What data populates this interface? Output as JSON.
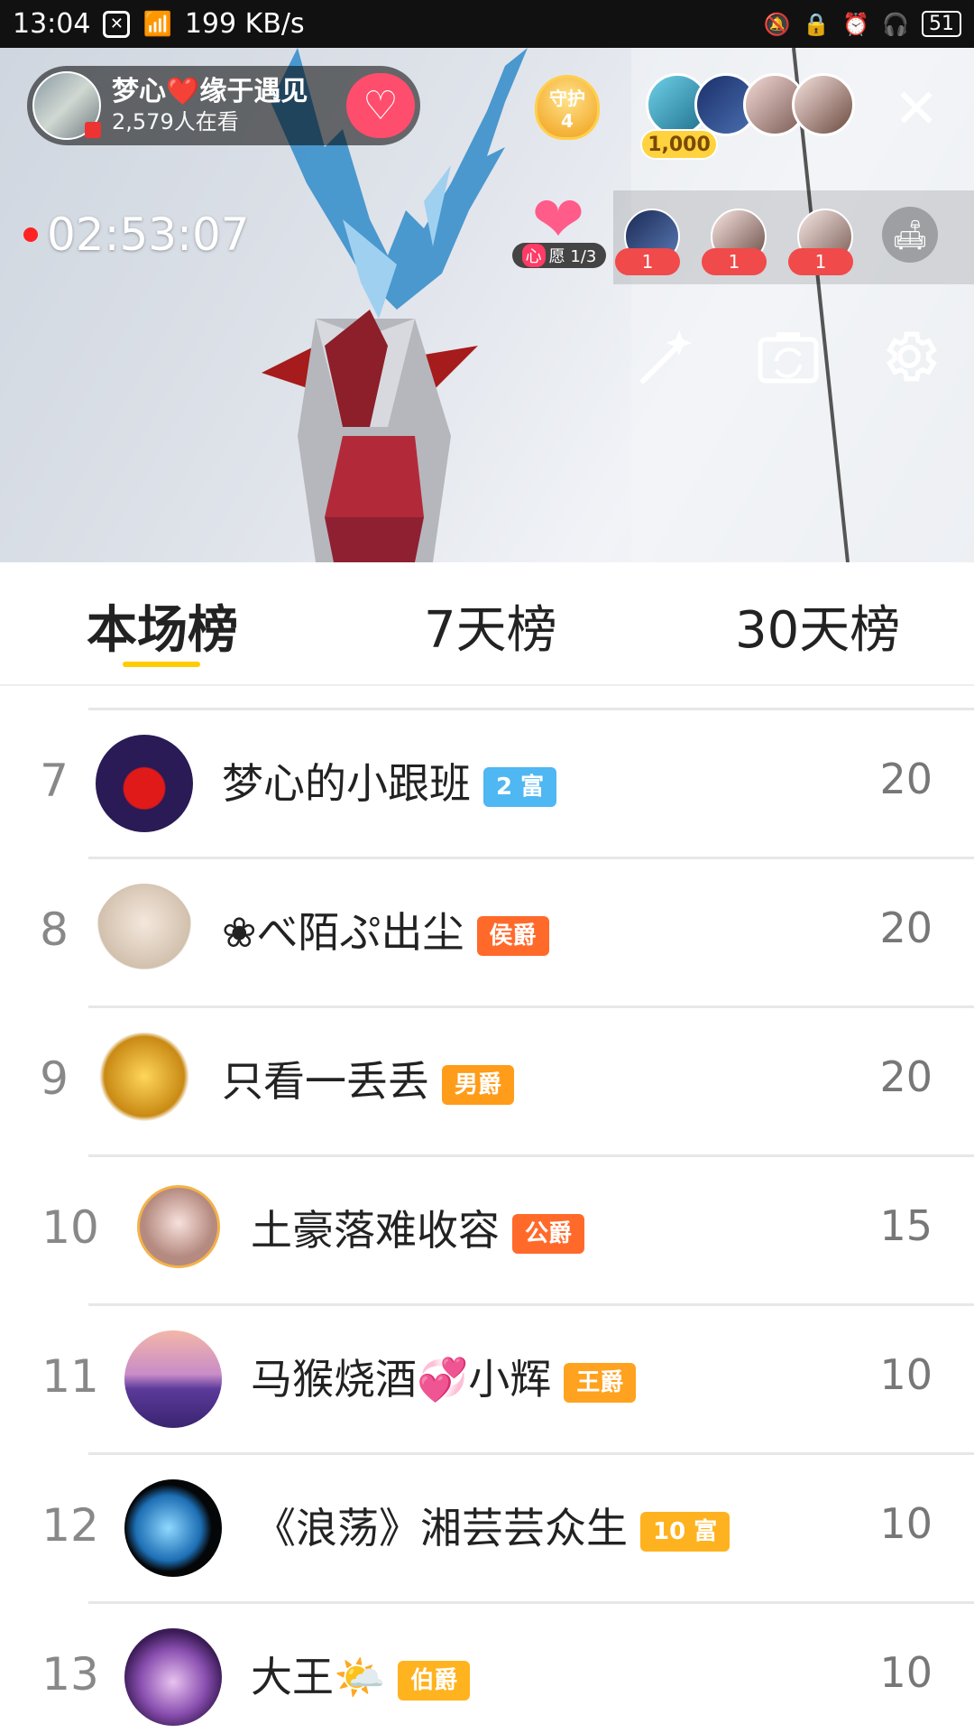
{
  "status_bar": {
    "time": "13:04",
    "speed": "199 KB/s",
    "battery": "51"
  },
  "host": {
    "name": "梦心❤️缘于遇见",
    "viewers": "2,579人在看"
  },
  "guard": {
    "label": "守护",
    "count": "4"
  },
  "top_coin": "1,000",
  "live_timer": "02:53:07",
  "wish": {
    "prefix": "心",
    "label": "愿 1/3"
  },
  "seats": [
    {
      "count": "1"
    },
    {
      "count": "1"
    },
    {
      "count": "1"
    }
  ],
  "tabs": [
    {
      "label": "本场榜"
    },
    {
      "label": "7天榜"
    },
    {
      "label": "30天榜"
    }
  ],
  "ranking": [
    {
      "rank": "7",
      "name": "梦心的小跟班",
      "badge": "2 富",
      "badge_color": "#4fb7f2",
      "score": "20"
    },
    {
      "rank": "8",
      "name": "❀べ陌ぷ出尘",
      "badge": "侯爵",
      "badge_color": "#ff6a2b",
      "score": "20"
    },
    {
      "rank": "9",
      "name": "只看一丢丢",
      "badge": "男爵",
      "badge_color": "#ff9c1a",
      "score": "20"
    },
    {
      "rank": "10",
      "name": "土豪落难收容",
      "badge": "公爵",
      "badge_color": "#ff6a2b",
      "score": "15"
    },
    {
      "rank": "11",
      "name": "马猴烧酒💞小辉",
      "badge": "王爵",
      "badge_color": "#ffa21f",
      "score": "10"
    },
    {
      "rank": "12",
      "name": "《浪荡》湘芸芸众生",
      "badge": "10 富",
      "badge_color": "#ffb21f",
      "score": "10"
    },
    {
      "rank": "13",
      "name": "大王🌤️",
      "badge": "伯爵",
      "badge_color": "#ffb31f",
      "score": "10"
    }
  ],
  "icons": {
    "close": "close-icon",
    "sofa": "sofa-icon",
    "magic": "magic-wand-icon",
    "camera_switch": "camera-switch-icon",
    "settings": "gear-icon"
  }
}
